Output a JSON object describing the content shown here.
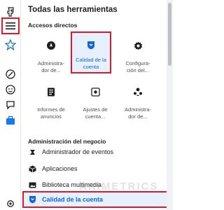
{
  "panel": {
    "title": "Todas las herramientas",
    "shortcuts_title": "Accesos directos",
    "business_title": "Administración del negocio"
  },
  "shortcuts": [
    {
      "label": "Administra-\ndor de...",
      "icon": "compass-icon"
    },
    {
      "label": "Calidad de la\ncuenta",
      "icon": "shield-icon"
    },
    {
      "label": "Configura-\nción del...",
      "icon": "gear-icon"
    },
    {
      "label": "Informes de\nanuncios",
      "icon": "report-icon"
    },
    {
      "label": "Ajustes de\ncuenta...",
      "icon": "account-settings-icon"
    },
    {
      "label": "Administra-\ndor de...",
      "icon": "people-icon"
    }
  ],
  "business_items": [
    {
      "label": "Administrador de eventos",
      "icon": "events-icon"
    },
    {
      "label": "Aplicaciones",
      "icon": "cube-icon"
    },
    {
      "label": "Biblioteca multimedia",
      "icon": "media-icon"
    }
  ],
  "selected_item": {
    "label": "Calidad de la cuenta",
    "icon": "shield-icon"
  },
  "watermark": "ARIMETRICS",
  "colors": {
    "accent": "#1665d8",
    "highlight": "#e3172a",
    "selected_bg": "#e7f0fd"
  }
}
